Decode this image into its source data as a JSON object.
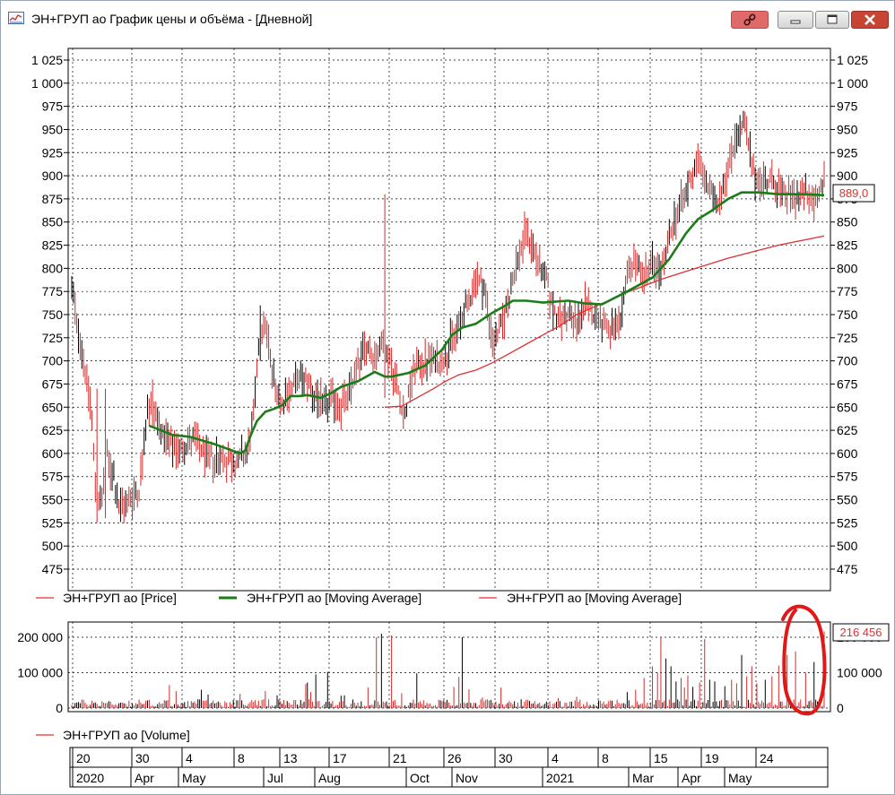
{
  "window": {
    "title": "ЭН+ГРУП ао График цены и объёма - [Дневной]",
    "icon": "chart-window-icon",
    "buttons": [
      "link-icon",
      "minimize-icon",
      "maximize-icon",
      "close-icon"
    ]
  },
  "colors": {
    "price": "#d42a2a",
    "price_black": "#000000",
    "ma_short": "#1a7d1a",
    "ma_long": "#e03030",
    "grid": "#000000",
    "badge_text": "#e03030",
    "annotation": "#e01818"
  },
  "legend": {
    "price": "ЭН+ГРУП ао [Price]",
    "ma1": "ЭН+ГРУП ао [Moving Average]",
    "ma2": "ЭН+ГРУП ао [Moving Average]",
    "volume": "ЭН+ГРУП ао [Volume]"
  },
  "badges": {
    "last_price": "889,0",
    "last_volume": "216 456"
  },
  "chart_data": {
    "type": "candlestick",
    "price_axis": {
      "ticks": [
        "1 025",
        "1 000",
        "975",
        "950",
        "925",
        "900",
        "875",
        "850",
        "825",
        "800",
        "775",
        "750",
        "725",
        "700",
        "675",
        "650",
        "625",
        "600",
        "575",
        "550",
        "525",
        "500",
        "475"
      ],
      "ylim": [
        475,
        1025
      ]
    },
    "volume_axis": {
      "ticks": [
        "200 000",
        "100 000",
        "0"
      ],
      "ylim": [
        0,
        200000
      ]
    },
    "date_axis": {
      "top": [
        "20",
        "30",
        "4",
        "8",
        "13",
        "17",
        "21",
        "26",
        "30",
        "4",
        "8",
        "15",
        "19",
        "24"
      ],
      "bottom": [
        "2020",
        "Apr",
        "May",
        "Jul",
        "Aug",
        "Oct",
        "Nov",
        "2021",
        "Mar",
        "Apr",
        "May"
      ]
    },
    "price_anchors": [
      [
        0,
        780
      ],
      [
        3,
        740
      ],
      [
        6,
        715
      ],
      [
        8,
        690
      ],
      [
        12,
        640
      ],
      [
        14,
        560
      ],
      [
        18,
        545
      ],
      [
        20,
        600
      ],
      [
        25,
        575
      ],
      [
        28,
        540
      ],
      [
        32,
        545
      ],
      [
        36,
        555
      ],
      [
        40,
        560
      ],
      [
        45,
        650
      ],
      [
        50,
        645
      ],
      [
        55,
        615
      ],
      [
        60,
        605
      ],
      [
        65,
        605
      ],
      [
        70,
        615
      ],
      [
        75,
        610
      ],
      [
        80,
        595
      ],
      [
        88,
        595
      ],
      [
        98,
        590
      ],
      [
        105,
        605
      ],
      [
        108,
        640
      ],
      [
        112,
        740
      ],
      [
        115,
        740
      ],
      [
        120,
        680
      ],
      [
        125,
        655
      ],
      [
        130,
        670
      ],
      [
        135,
        680
      ],
      [
        140,
        680
      ],
      [
        145,
        660
      ],
      [
        150,
        650
      ],
      [
        155,
        660
      ],
      [
        160,
        650
      ],
      [
        165,
        665
      ],
      [
        170,
        700
      ],
      [
        175,
        715
      ],
      [
        180,
        705
      ],
      [
        185,
        720
      ],
      [
        190,
        695
      ],
      [
        195,
        660
      ],
      [
        198,
        640
      ],
      [
        203,
        690
      ],
      [
        210,
        700
      ],
      [
        220,
        700
      ],
      [
        228,
        730
      ],
      [
        235,
        760
      ],
      [
        240,
        790
      ],
      [
        245,
        780
      ],
      [
        250,
        720
      ],
      [
        255,
        735
      ],
      [
        260,
        770
      ],
      [
        265,
        810
      ],
      [
        270,
        840
      ],
      [
        275,
        820
      ],
      [
        278,
        800
      ],
      [
        282,
        790
      ],
      [
        285,
        760
      ],
      [
        290,
        745
      ],
      [
        295,
        750
      ],
      [
        300,
        740
      ],
      [
        305,
        760
      ],
      [
        310,
        750
      ],
      [
        315,
        745
      ],
      [
        320,
        730
      ],
      [
        326,
        735
      ],
      [
        330,
        800
      ],
      [
        335,
        805
      ],
      [
        340,
        795
      ],
      [
        345,
        805
      ],
      [
        350,
        795
      ],
      [
        355,
        830
      ],
      [
        360,
        865
      ],
      [
        365,
        880
      ],
      [
        368,
        900
      ],
      [
        372,
        920
      ],
      [
        376,
        895
      ],
      [
        380,
        880
      ],
      [
        383,
        870
      ],
      [
        386,
        885
      ],
      [
        390,
        910
      ],
      [
        395,
        945
      ],
      [
        400,
        955
      ],
      [
        405,
        900
      ],
      [
        410,
        895
      ],
      [
        415,
        895
      ],
      [
        420,
        885
      ],
      [
        425,
        880
      ],
      [
        430,
        875
      ],
      [
        435,
        880
      ],
      [
        440,
        870
      ],
      [
        445,
        885
      ],
      [
        447,
        889
      ]
    ],
    "ma_short": [
      [
        46,
        630
      ],
      [
        60,
        620
      ],
      [
        70,
        618
      ],
      [
        85,
        610
      ],
      [
        100,
        600
      ],
      [
        103,
        603
      ],
      [
        106,
        618
      ],
      [
        110,
        635
      ],
      [
        115,
        645
      ],
      [
        120,
        648
      ],
      [
        125,
        652
      ],
      [
        130,
        662
      ],
      [
        135,
        662
      ],
      [
        140,
        663
      ],
      [
        148,
        660
      ],
      [
        155,
        666
      ],
      [
        160,
        672
      ],
      [
        170,
        678
      ],
      [
        180,
        688
      ],
      [
        186,
        683
      ],
      [
        190,
        683
      ],
      [
        200,
        687
      ],
      [
        210,
        695
      ],
      [
        220,
        712
      ],
      [
        226,
        728
      ],
      [
        232,
        736
      ],
      [
        236,
        738
      ],
      [
        240,
        740
      ],
      [
        250,
        752
      ],
      [
        256,
        758
      ],
      [
        262,
        765
      ],
      [
        270,
        765
      ],
      [
        280,
        763
      ],
      [
        295,
        765
      ],
      [
        305,
        762
      ],
      [
        315,
        761
      ],
      [
        330,
        775
      ],
      [
        345,
        790
      ],
      [
        355,
        810
      ],
      [
        365,
        838
      ],
      [
        372,
        853
      ],
      [
        380,
        862
      ],
      [
        390,
        875
      ],
      [
        398,
        882
      ],
      [
        408,
        882
      ],
      [
        420,
        880
      ],
      [
        435,
        880
      ],
      [
        447,
        879
      ]
    ],
    "ma_long": [
      [
        186,
        650
      ],
      [
        196,
        651
      ],
      [
        205,
        660
      ],
      [
        215,
        670
      ],
      [
        222,
        678
      ],
      [
        230,
        685
      ],
      [
        240,
        690
      ],
      [
        250,
        698
      ],
      [
        260,
        708
      ],
      [
        270,
        718
      ],
      [
        280,
        728
      ],
      [
        290,
        738
      ],
      [
        300,
        750
      ],
      [
        310,
        758
      ],
      [
        320,
        766
      ],
      [
        330,
        774
      ],
      [
        340,
        781
      ],
      [
        350,
        788
      ],
      [
        362,
        795
      ],
      [
        376,
        803
      ],
      [
        390,
        811
      ],
      [
        405,
        818
      ],
      [
        420,
        825
      ],
      [
        447,
        835
      ]
    ],
    "volume_spikes": [
      [
        181,
        200000
      ],
      [
        184,
        210000
      ],
      [
        190,
        205000
      ],
      [
        232,
        200000
      ],
      [
        205,
        98000
      ],
      [
        140,
        72000
      ],
      [
        145,
        95000
      ],
      [
        152,
        102000
      ],
      [
        58,
        65000
      ],
      [
        62,
        48000
      ],
      [
        77,
        52000
      ],
      [
        81,
        38000
      ],
      [
        100,
        40000
      ],
      [
        115,
        48000
      ],
      [
        122,
        36000
      ],
      [
        139,
        68000
      ],
      [
        142,
        45000
      ],
      [
        160,
        35000
      ],
      [
        162,
        36000
      ],
      [
        176,
        58000
      ],
      [
        196,
        42000
      ],
      [
        227,
        60000
      ],
      [
        230,
        88000
      ],
      [
        236,
        53000
      ],
      [
        244,
        30000
      ],
      [
        255,
        58000
      ],
      [
        289,
        28000
      ],
      [
        300,
        32000
      ],
      [
        330,
        45000
      ],
      [
        335,
        52000
      ],
      [
        340,
        85000
      ],
      [
        345,
        118000
      ],
      [
        348,
        100000
      ],
      [
        350,
        200000
      ],
      [
        353,
        140000
      ],
      [
        356,
        118000
      ],
      [
        359,
        75000
      ],
      [
        362,
        85000
      ],
      [
        364,
        58000
      ],
      [
        366,
        92000
      ],
      [
        369,
        60000
      ],
      [
        373,
        72000
      ],
      [
        376,
        195000
      ],
      [
        379,
        80000
      ],
      [
        382,
        75000
      ],
      [
        388,
        62000
      ],
      [
        392,
        80000
      ],
      [
        395,
        70000
      ],
      [
        398,
        150000
      ],
      [
        401,
        90000
      ],
      [
        404,
        118000
      ],
      [
        407,
        70000
      ],
      [
        412,
        80000
      ],
      [
        416,
        90000
      ],
      [
        420,
        120000
      ],
      [
        425,
        150000
      ],
      [
        430,
        160000
      ],
      [
        436,
        100000
      ],
      [
        441,
        130000
      ],
      [
        447,
        216456
      ]
    ]
  }
}
